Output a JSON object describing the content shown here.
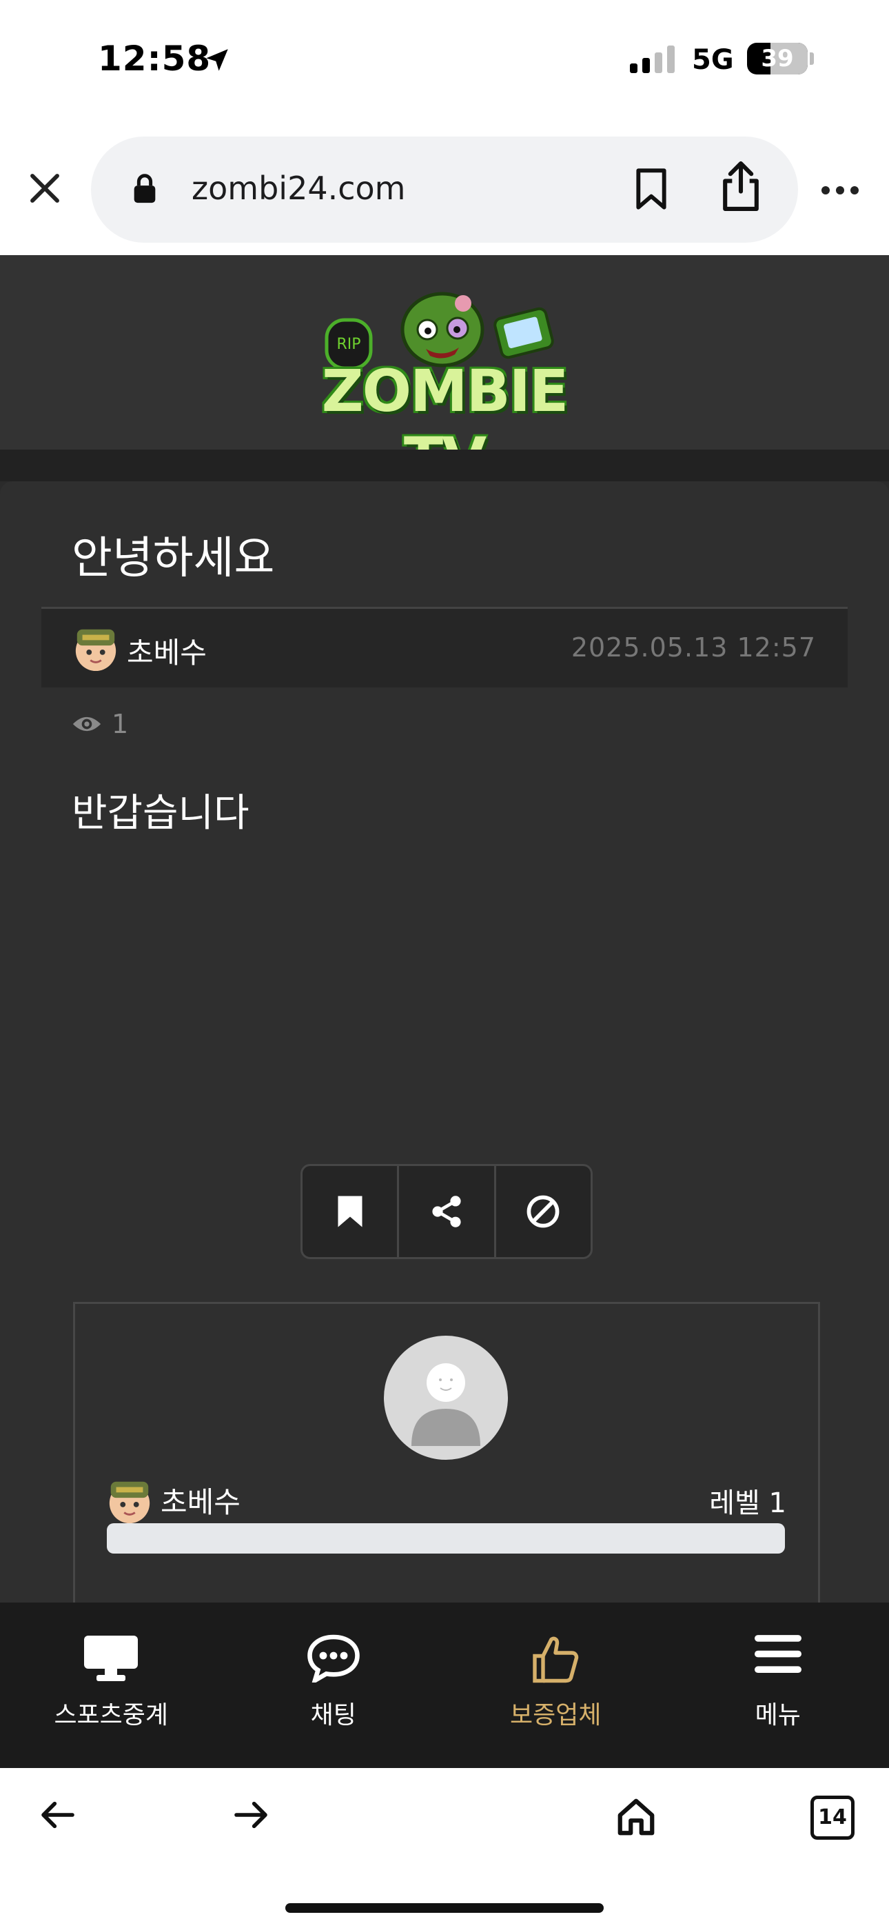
{
  "status_bar": {
    "time": "12:58",
    "network": "5G",
    "battery": "39",
    "battery_level": 0.39
  },
  "browser": {
    "url": "zombi24.com",
    "tab_count": "14",
    "icons": [
      "close-icon",
      "lock-icon",
      "bookmark-icon",
      "share-icon",
      "more-icon",
      "back-icon",
      "forward-icon",
      "home-icon",
      "tabs-icon"
    ]
  },
  "site": {
    "logo_text": "ZOMBIE TV",
    "logo_sign": "RIP"
  },
  "post": {
    "title": "안녕하세요",
    "author": "초베수",
    "date": "2025.05.13 12:57",
    "views": "1",
    "body": "반갑습니다",
    "actions": [
      "bookmark-icon",
      "share-icon",
      "ban-icon"
    ]
  },
  "profile": {
    "name": "초베수",
    "level": "레벨 1",
    "progress": 0
  },
  "nav": [
    {
      "label": "스포츠중계",
      "icon": "monitor-icon",
      "active": false
    },
    {
      "label": "채팅",
      "icon": "chat-icon",
      "active": false
    },
    {
      "label": "보증업체",
      "icon": "thumbs-up-icon",
      "active": true
    },
    {
      "label": "메뉴",
      "icon": "menu-icon",
      "active": false
    }
  ],
  "colors": {
    "accent": "#d6b06a",
    "page_bg": "#2f2f2f",
    "header_bg": "#333333",
    "nav_bg": "#1b1b1b"
  }
}
